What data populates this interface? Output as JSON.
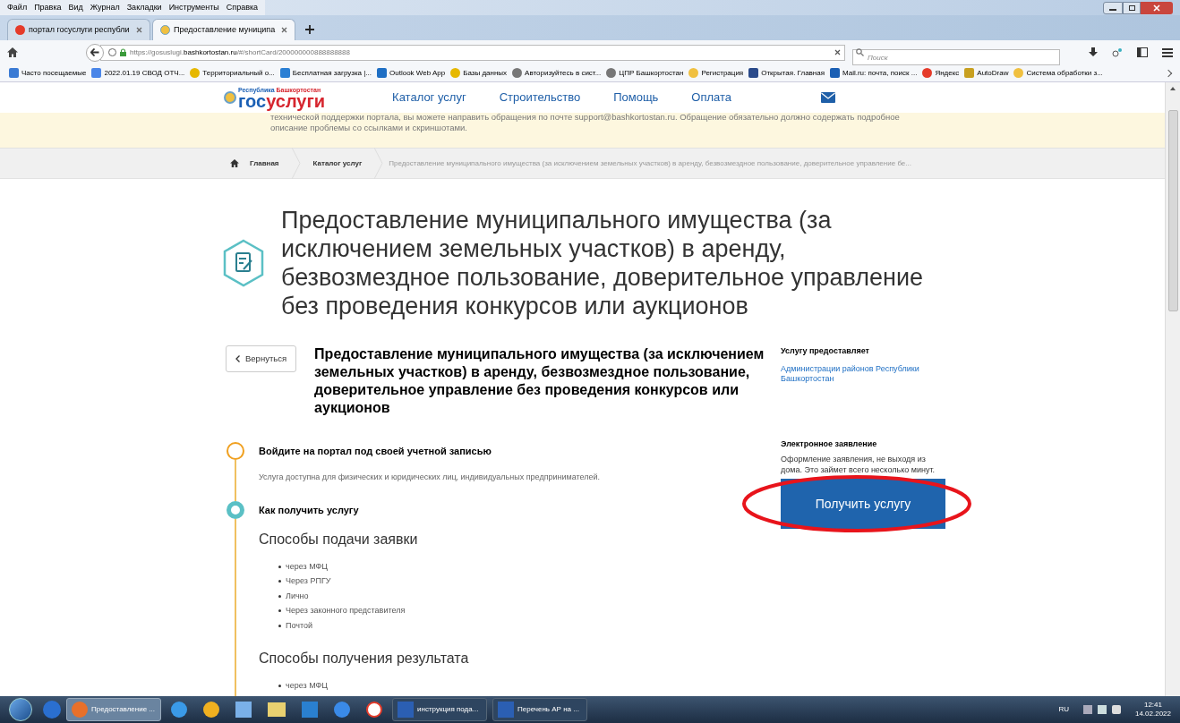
{
  "menu": [
    "Файл",
    "Правка",
    "Вид",
    "Журнал",
    "Закладки",
    "Инструменты",
    "Справка"
  ],
  "tabs": [
    {
      "label": "портал госуслуги республи",
      "selected": false
    },
    {
      "label": "Предоставление муниципа",
      "selected": true
    }
  ],
  "url": {
    "host_before": "https://gosuslugi.",
    "host_bold": "bashkortostan.ru",
    "path": "/#/shortCard/200000000888888888"
  },
  "search": {
    "placeholder": "Поиск"
  },
  "bookmarks": [
    "Часто посещаемые",
    "2022.01.19 СВОД ОТЧ...",
    "Территориальный о...",
    "Бесплатная загрузка |...",
    "Outlook Web App",
    "Базы данных",
    "Авторизуйтесь в сист...",
    "ЦПР Башкортостан",
    "Регистрация",
    "Открытая. Главная",
    "Mail.ru: почта, поиск ...",
    "Яндекс",
    "AutoDraw",
    "Система обработки з..."
  ],
  "header": {
    "logo_caption_left": "Республика",
    "logo_caption_right": "Башкортостан",
    "logo_word_left": "гос",
    "logo_word_right": "услуги",
    "nav": [
      "Каталог услуг",
      "Строительство",
      "Помощь",
      "Оплата"
    ]
  },
  "notice": [
    "технической поддержки портала, вы можете направить обращения по почте support@bashkortostan.ru. Обращение обязательно должно содержать подробное",
    "описание проблемы со ссылками и скриншотами."
  ],
  "breadcrumbs": [
    "Главная",
    "Каталог услуг",
    "Предоставление муниципального имущества (за исключением земельных участков) в аренду, безвозмездное пользование, доверительное управление бе..."
  ],
  "title": "Предоставление муниципального имущества (за исключением земельных участков) в аренду, безвозмездное пользование, доверительное управление без проведения конкурсов или аукционов",
  "back_button": "Вернуться",
  "service_title": "Предоставление муниципального имущества (за исключением земельных участков) в аренду, безвозмездное пользование, доверительное управление без проведения конкурсов или аукционов",
  "steps": [
    {
      "title": "Войдите на портал под своей учетной записью",
      "text": "Услуга доступна для физических и юридических лиц, индивидуальных предпринимателей.",
      "kind": "pending"
    },
    {
      "title": "Как получить услугу",
      "kind": "active",
      "sections": [
        {
          "heading": "Способы подачи заявки",
          "items": [
            "через МФЦ",
            "Через РПГУ",
            "Лично",
            "Через законного представителя",
            "Почтой"
          ]
        },
        {
          "heading": "Способы получения результата",
          "items": [
            "через МФЦ"
          ]
        }
      ]
    }
  ],
  "provider": {
    "heading": "Услугу предоставляет",
    "link": "Администрации районов Республики Башкортостан"
  },
  "e_application": {
    "heading": "Электронное заявление",
    "text": "Оформление заявления, не выходя из дома. Это займет всего несколько минут.",
    "button": "Получить услугу",
    "highlighted": true
  },
  "taskbar": {
    "items": [
      {
        "label": "Предоставление ...",
        "kind": "firefox",
        "selected": true
      },
      {
        "kind": "ie",
        "selected": false
      },
      {
        "label": "инструкция пода...",
        "kind": "word",
        "selected": false
      },
      {
        "label": "Перечень АР на ...",
        "kind": "word",
        "selected": false
      }
    ],
    "language": "RU",
    "time": "12:41",
    "date": "14.02.2022"
  }
}
